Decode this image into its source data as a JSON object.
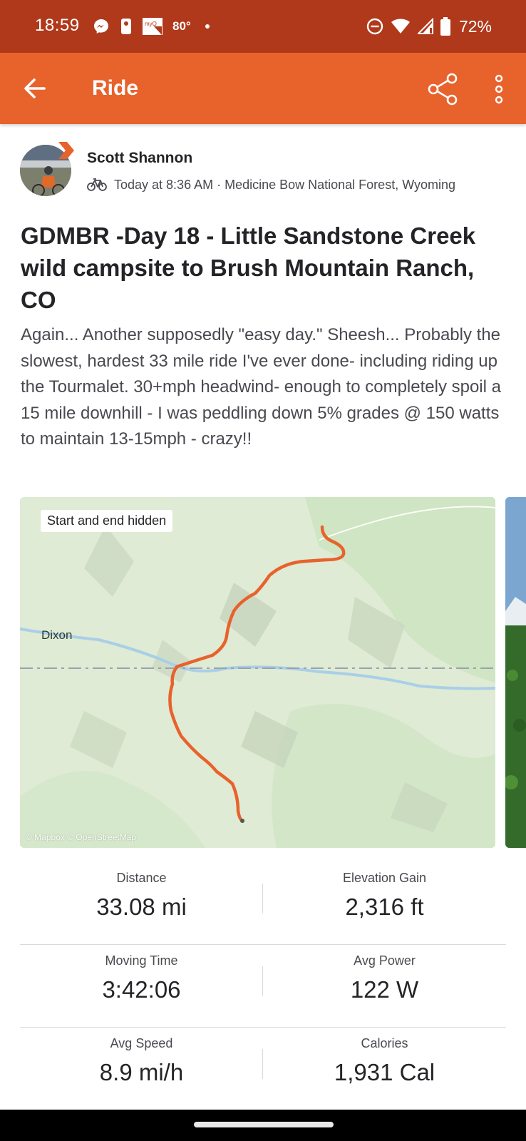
{
  "status_bar": {
    "time": "18:59",
    "temperature": "80°",
    "battery": "72%",
    "notification_icons": [
      "messenger-icon",
      "key-icon",
      "myq-icon"
    ],
    "myq_label": "myQ"
  },
  "app_bar": {
    "title": "Ride",
    "color": "#e8622c"
  },
  "athlete": {
    "name": "Scott Shannon",
    "activity_type_icon": "bicycle-icon",
    "meta": "Today at 8:36 AM · Medicine Bow National Forest, Wyoming"
  },
  "activity": {
    "title": "GDMBR -Day 18 - Little Sandstone Creek wild campsite to Brush Mountain Ranch, CO",
    "description": "Again... Another supposedly \"easy day.\" Sheesh... Probably the slowest, hardest 33 mile ride I've ever done- including riding up the Tourmalet. 30+mph headwind- enough to completely spoil a 15 mile downhill - I was peddling down 5% grades @ 150 watts to maintain 13-15mph - crazy!!"
  },
  "map": {
    "badge": "Start and end hidden",
    "town": "Dixon",
    "attribution": "© Mapbox © OpenStreetMap",
    "route_color": "#e8622c"
  },
  "stats": [
    {
      "label": "Distance",
      "value": "33.08 mi"
    },
    {
      "label": "Elevation Gain",
      "value": "2,316 ft"
    },
    {
      "label": "Moving Time",
      "value": "3:42:06"
    },
    {
      "label": "Avg Power",
      "value": "122 W"
    },
    {
      "label": "Avg Speed",
      "value": "8.9 mi/h"
    },
    {
      "label": "Calories",
      "value": "1,931 Cal"
    }
  ]
}
